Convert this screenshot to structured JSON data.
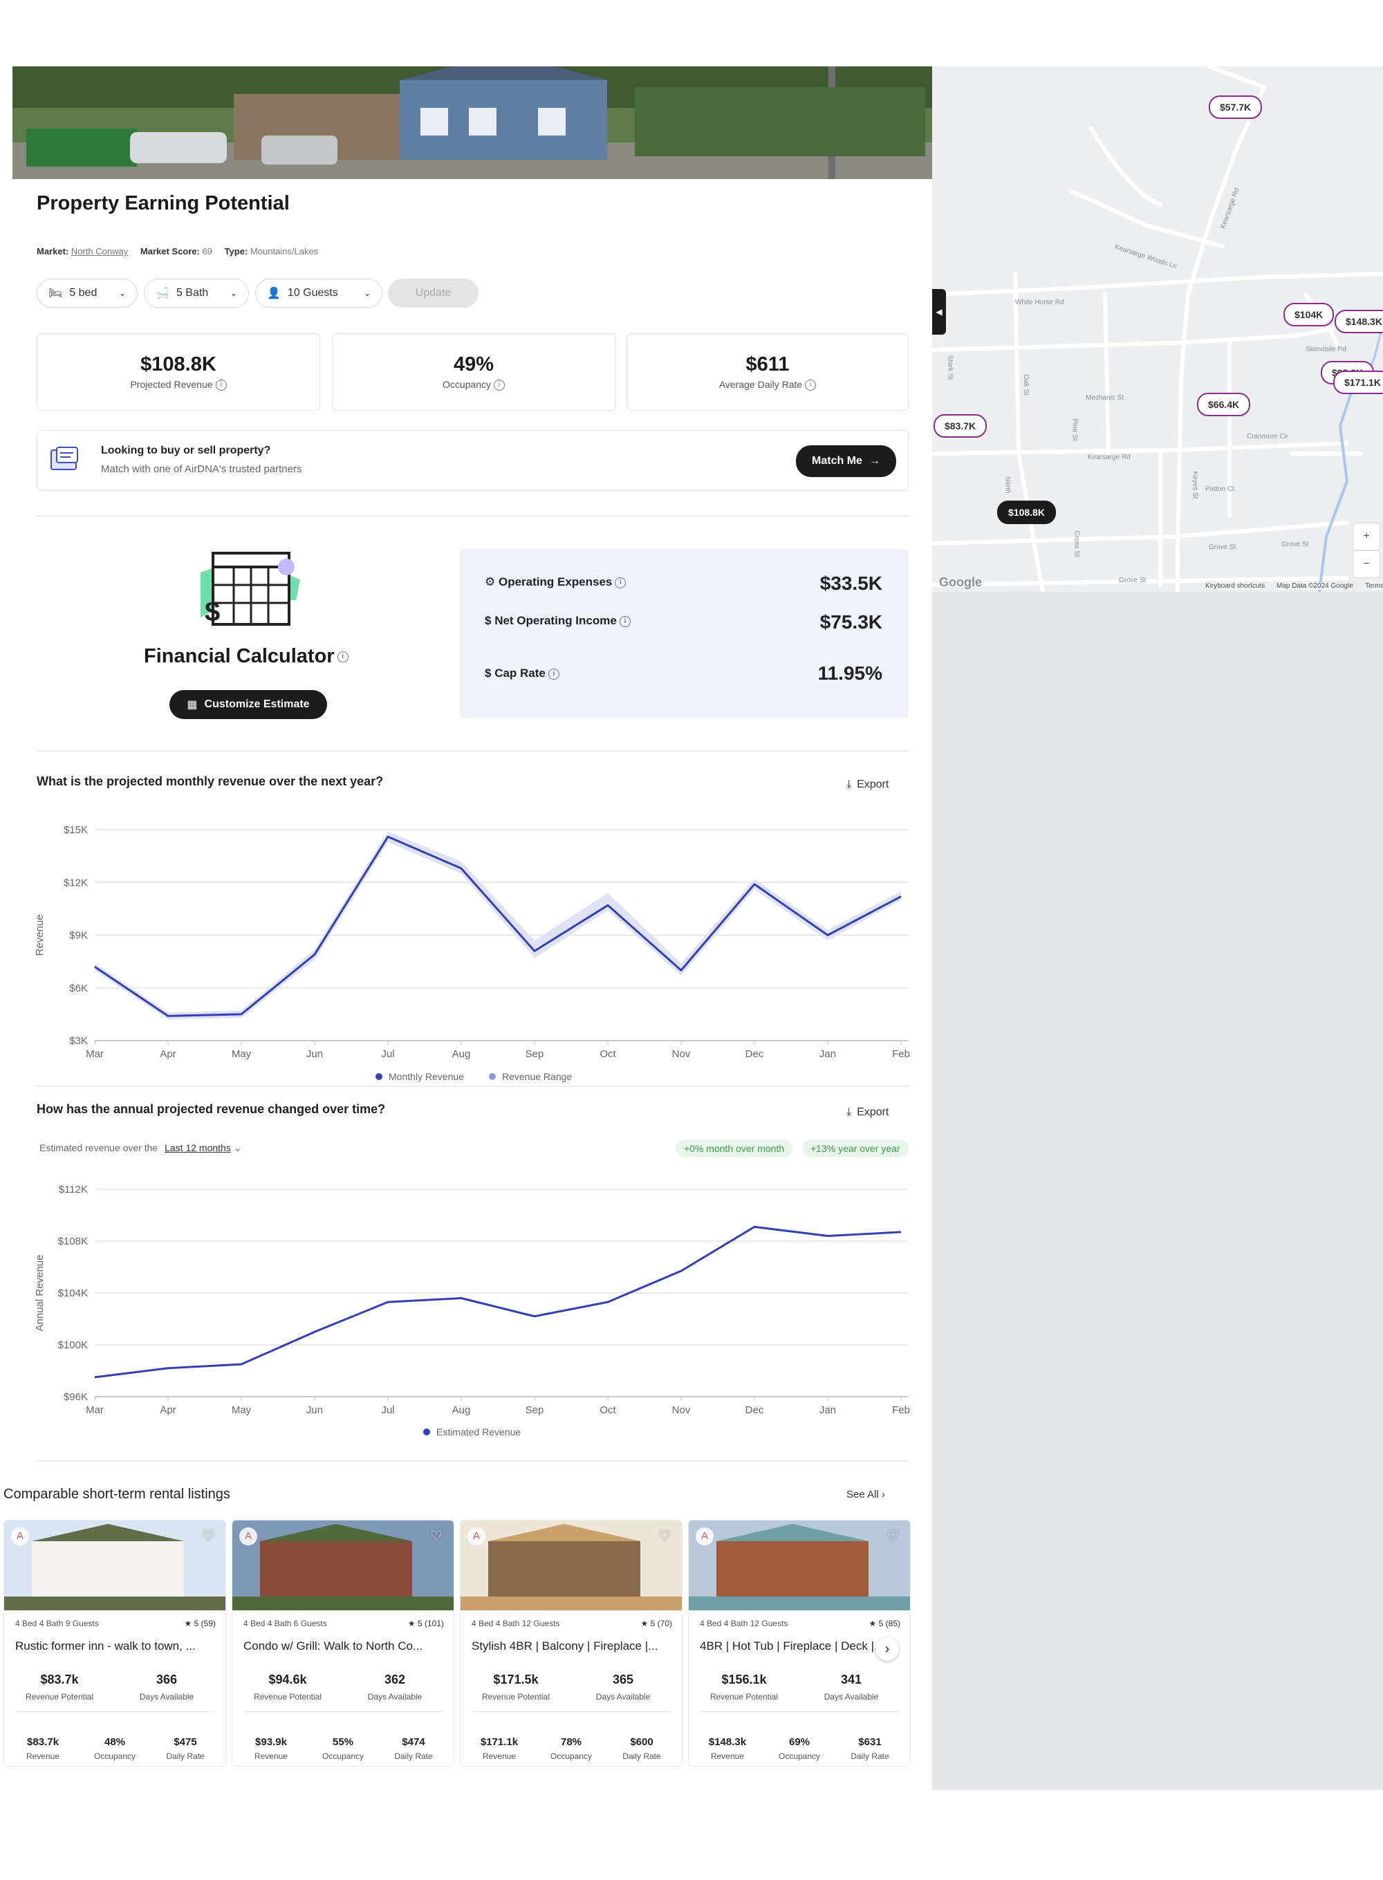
{
  "hero": {
    "alt": "property photo"
  },
  "title": "Property Earning Potential",
  "market": {
    "market_label": "Market:",
    "market_value": "North Conway",
    "score_label": "Market Score:",
    "score_value": "69",
    "type_label": "Type:",
    "type_value": "Mountains/Lakes"
  },
  "filters": {
    "beds": "5 bed",
    "baths": "5 Bath",
    "guests": "10 Guests",
    "update": "Update"
  },
  "stats": [
    {
      "value": "$108.8K",
      "label": "Projected Revenue"
    },
    {
      "value": "49%",
      "label": "Occupancy"
    },
    {
      "value": "$611",
      "label": "Average Daily Rate"
    }
  ],
  "partner": {
    "title": "Looking to buy or sell property?",
    "subtitle": "Match with one of AirDNA's trusted partners",
    "button": "Match Me"
  },
  "calculator": {
    "title": "Financial Calculator",
    "button": "Customize Estimate",
    "rows": [
      {
        "label": "Operating Expenses",
        "value": "$33.5K"
      },
      {
        "label": "Net Operating Income",
        "value": "$75.3K"
      },
      {
        "label": "Cap Rate",
        "value": "11.95%"
      }
    ]
  },
  "monthly": {
    "question": "What is the projected monthly revenue over the next year?",
    "export": "Export"
  },
  "annual": {
    "question": "How has the annual projected revenue changed over time?",
    "export": "Export",
    "est_prefix": "Estimated revenue over the",
    "period": "Last 12 months",
    "mom": "+0% month over month",
    "yoy": "+13% year over year"
  },
  "chart_data": [
    {
      "type": "line",
      "ylabel": "Revenue",
      "x": [
        "Mar",
        "Apr",
        "May",
        "Jun",
        "Jul",
        "Aug",
        "Sep",
        "Oct",
        "Nov",
        "Dec",
        "Jan",
        "Feb"
      ],
      "yticks": [
        "$3K",
        "$6K",
        "$9K",
        "$12K",
        "$15K"
      ],
      "ylim": [
        3000,
        15000
      ],
      "series": [
        {
          "name": "Monthly Revenue",
          "values": [
            7200,
            4400,
            4500,
            7900,
            14600,
            12800,
            8100,
            10700,
            7000,
            11900,
            9000,
            11200
          ]
        }
      ],
      "band": {
        "name": "Revenue Range",
        "low": [
          7000,
          4200,
          4300,
          7600,
          14300,
          12500,
          7700,
          10400,
          6700,
          11600,
          8700,
          11000
        ],
        "high": [
          7400,
          4600,
          4700,
          8200,
          14900,
          13200,
          8700,
          11400,
          7400,
          12200,
          9300,
          11500
        ]
      },
      "legend": [
        "Monthly Revenue",
        "Revenue Range"
      ]
    },
    {
      "type": "line",
      "ylabel": "Annual Revenue",
      "x": [
        "Mar",
        "Apr",
        "May",
        "Jun",
        "Jul",
        "Aug",
        "Sep",
        "Oct",
        "Nov",
        "Dec",
        "Jan",
        "Feb"
      ],
      "yticks": [
        "$96K",
        "$100K",
        "$104K",
        "$108K",
        "$112K"
      ],
      "ylim": [
        96000,
        112000
      ],
      "series": [
        {
          "name": "Estimated Revenue",
          "values": [
            97500,
            98200,
            98500,
            101000,
            103300,
            103600,
            102200,
            103300,
            105700,
            109100,
            108400,
            108700
          ]
        }
      ],
      "legend": [
        "Estimated Revenue"
      ]
    }
  ],
  "comparables": {
    "title": "Comparable short-term rental listings",
    "see_all": "See All",
    "items": [
      {
        "meta": "4 Bed  4 Bath  9 Guests",
        "rating": "★ 5 (59)",
        "title": "Rustic former inn - walk to town, ...",
        "rev_pot": "$83.7k",
        "days": "366",
        "rev": "$83.7k",
        "occ": "48%",
        "adr": "$475"
      },
      {
        "meta": "4 Bed  4 Bath  6 Guests",
        "rating": "★ 5 (101)",
        "title": "Condo w/ Grill: Walk to North Co...",
        "rev_pot": "$94.6k",
        "days": "362",
        "rev": "$93.9k",
        "occ": "55%",
        "adr": "$474"
      },
      {
        "meta": "4 Bed  4 Bath  12 Guests",
        "rating": "★ 5 (70)",
        "title": "Stylish 4BR | Balcony | Fireplace |...",
        "rev_pot": "$171.5k",
        "days": "365",
        "rev": "$171.1k",
        "occ": "78%",
        "adr": "$600"
      },
      {
        "meta": "4 Bed  4 Bath  12 Guests",
        "rating": "★ 5 (85)",
        "title": "4BR | Hot Tub | Fireplace | Deck |...",
        "rev_pot": "$156.1k",
        "days": "341",
        "rev": "$148.3k",
        "occ": "69%",
        "adr": "$631"
      }
    ],
    "labels": {
      "rev_pot": "Revenue Potential",
      "days": "Days Available",
      "rev": "Revenue",
      "occ": "Occupancy",
      "adr": "Daily Rate"
    }
  },
  "map": {
    "pins": [
      "$57.7K",
      "$104K",
      "$148.3K",
      "$93.9K",
      "$171.1K",
      "$66.4K",
      "$83.7K",
      "$108.8K"
    ],
    "roads": [
      "Kearsarge Woods Ln",
      "White Horse Rd",
      "Kearsarge Rd",
      "Skimobile Rd",
      "Mechanic St",
      "Kearsarge Rd",
      "Stark St",
      "Oak St",
      "Pine St",
      "Cranmore Cir",
      "Patton Ct",
      "Grove St",
      "Grove St",
      "Grove St",
      "Cross St",
      "Keyes St",
      "North"
    ],
    "footer": [
      "Keyboard shortcuts",
      "Map Data ©2024 Google",
      "Terms"
    ],
    "google": "Google",
    "zoom_in": "+",
    "zoom_out": "−"
  }
}
